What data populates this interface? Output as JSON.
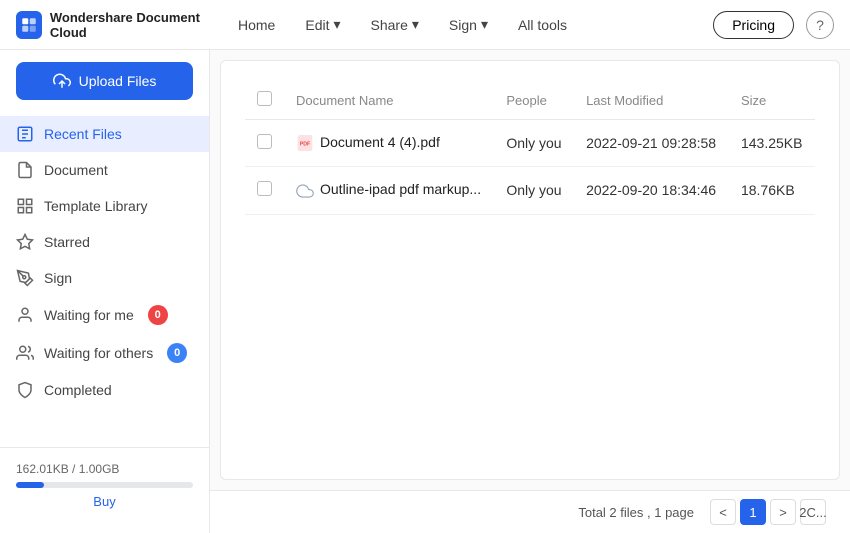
{
  "topnav": {
    "logo_text": "Wondershare Document Cloud",
    "nav_links": [
      {
        "label": "Home",
        "has_arrow": false
      },
      {
        "label": "Edit",
        "has_arrow": true
      },
      {
        "label": "Share",
        "has_arrow": true
      },
      {
        "label": "Sign",
        "has_arrow": true
      },
      {
        "label": "All tools",
        "has_arrow": false
      }
    ],
    "pricing_label": "Pricing",
    "help_label": "?"
  },
  "sidebar": {
    "upload_label": "Upload Files",
    "items": [
      {
        "id": "recent-files",
        "label": "Recent Files",
        "icon": "recent"
      },
      {
        "id": "document",
        "label": "Document",
        "icon": "document"
      },
      {
        "id": "template-library",
        "label": "Template Library",
        "icon": "template"
      },
      {
        "id": "starred",
        "label": "Starred",
        "icon": "star"
      },
      {
        "id": "sign",
        "label": "Sign",
        "icon": "sign"
      },
      {
        "id": "waiting-for-me",
        "label": "Waiting for me",
        "icon": "waiting-me",
        "badge": "0",
        "badge_color": "red"
      },
      {
        "id": "waiting-for-others",
        "label": "Waiting for others",
        "icon": "waiting-others",
        "badge": "0",
        "badge_color": "blue"
      },
      {
        "id": "completed",
        "label": "Completed",
        "icon": "completed"
      }
    ],
    "storage_used": "162.01KB / 1.00GB",
    "buy_label": "Buy"
  },
  "table": {
    "columns": [
      "",
      "Document Name",
      "People",
      "Last Modified",
      "Size"
    ],
    "rows": [
      {
        "icon": "pdf",
        "name": "Document 4 (4).pdf",
        "people": "Only you",
        "last_modified": "2022-09-21 09:28:58",
        "size": "143.25KB"
      },
      {
        "icon": "cloud",
        "name": "Outline-ipad pdf markup...",
        "people": "Only you",
        "last_modified": "2022-09-20 18:34:46",
        "size": "18.76KB"
      }
    ]
  },
  "pagination": {
    "total_info": "Total 2 files , 1 page",
    "current_page": "1",
    "next_label": ">",
    "prev_label": "<",
    "last_label": "2C..."
  }
}
